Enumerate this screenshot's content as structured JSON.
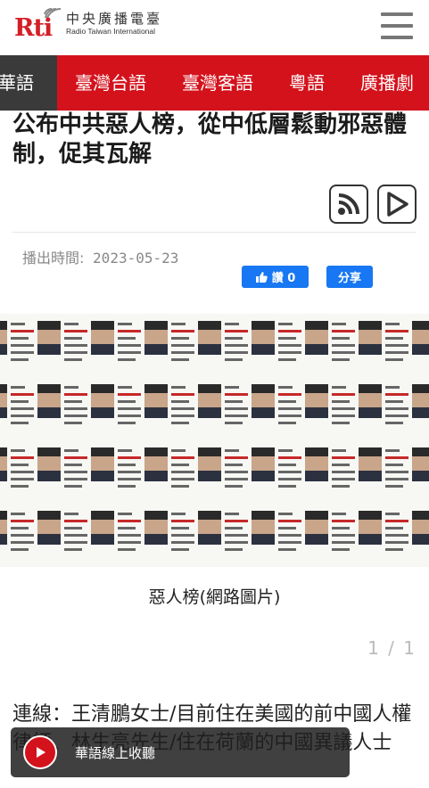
{
  "header": {
    "logo_mark": "Rti",
    "logo_cn": "中央廣播電臺",
    "logo_en": "Radio Taiwan International",
    "menu_icon": "hamburger-icon"
  },
  "lang_nav": {
    "items": [
      {
        "label": "華語",
        "active": true
      },
      {
        "label": "臺灣台語"
      },
      {
        "label": "臺灣客語"
      },
      {
        "label": "粵語"
      },
      {
        "label": "廣播劇"
      }
    ]
  },
  "article": {
    "title": "公布中共惡人榜，從中低層鬆動邪惡體制，促其瓦解",
    "date_label": "播出時間:",
    "date_value": "2023-05-23",
    "caption": "惡人榜(網路圖片)",
    "pager": "1 / 1",
    "body": "連線：王清鵬女士/目前住在美國的前中國人權律師、林生亮先生/住在荷蘭的中國異議人士"
  },
  "media_buttons": {
    "rss_icon": "rss-icon",
    "play_icon": "play-icon"
  },
  "social": {
    "like_label": "讚 0",
    "share_label": "分享"
  },
  "audio_player": {
    "label": "華語線上收聽"
  },
  "colors": {
    "brand_red": "#d4121c",
    "facebook_blue": "#1877f2"
  }
}
